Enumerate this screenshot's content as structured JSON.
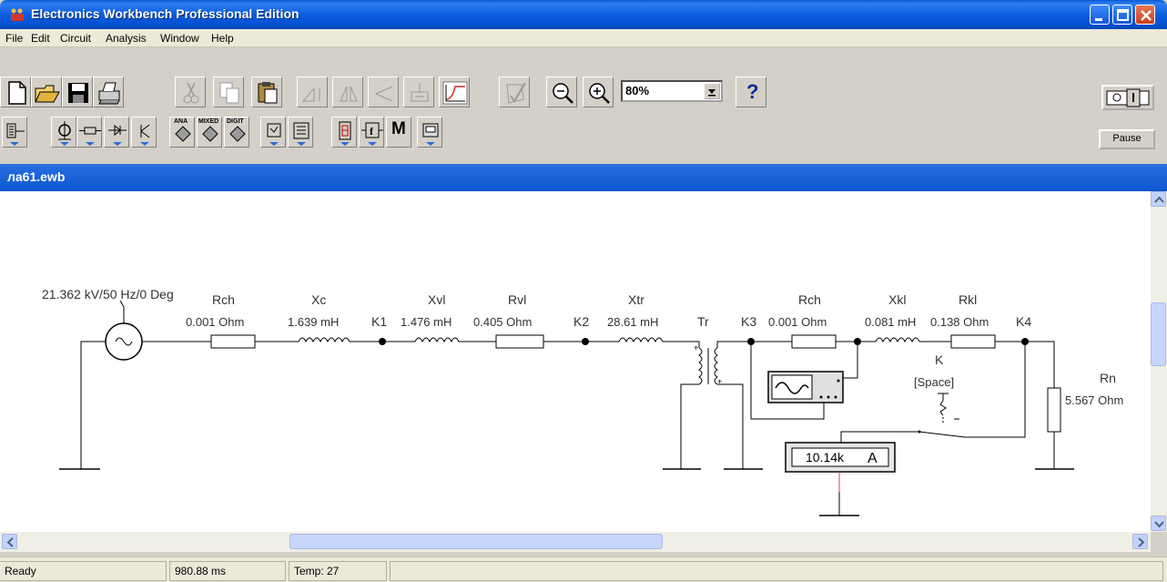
{
  "window": {
    "title": "Electronics Workbench Professional Edition"
  },
  "menu": {
    "items": [
      "File",
      "Edit",
      "Circuit",
      "Analysis",
      "Window",
      "Help"
    ]
  },
  "toolbar": {
    "zoom_value": "80%",
    "help_label": "?",
    "pause_label": "Pause",
    "component_labels": {
      "ana": "ANA",
      "mixed": "MIXED",
      "digit": "DIGIT",
      "misc": "M"
    }
  },
  "document": {
    "title": "ла61.ewb"
  },
  "circuit": {
    "source_label": "21.362 kV/50 Hz/0 Deg",
    "components": [
      {
        "name": "Rch",
        "value": "0.001  Ohm"
      },
      {
        "name": "Xc",
        "value": "1.639 mH"
      },
      {
        "name": "K1",
        "value": ""
      },
      {
        "name": "Xvl",
        "value": "1.476 mH"
      },
      {
        "name": "Rvl",
        "value": "0.405  Ohm"
      },
      {
        "name": "K2",
        "value": ""
      },
      {
        "name": "Xtr",
        "value": "28.61 mH"
      },
      {
        "name": "Tr",
        "value": ""
      },
      {
        "name": "K3",
        "value": ""
      },
      {
        "name": "Rch",
        "value": "0.001  Ohm"
      },
      {
        "name": "Xkl",
        "value": "0.081 mH"
      },
      {
        "name": "Rkl",
        "value": "0.138  Ohm"
      },
      {
        "name": "K4",
        "value": ""
      },
      {
        "name": "K",
        "value": "[Space]"
      },
      {
        "name": "Rn",
        "value": "5.567  Ohm"
      }
    ],
    "ammeter_reading": "10.14k",
    "ammeter_unit": "A"
  },
  "status": {
    "message": "Ready",
    "time": "980.88 ms",
    "temp": "Temp: 27"
  }
}
